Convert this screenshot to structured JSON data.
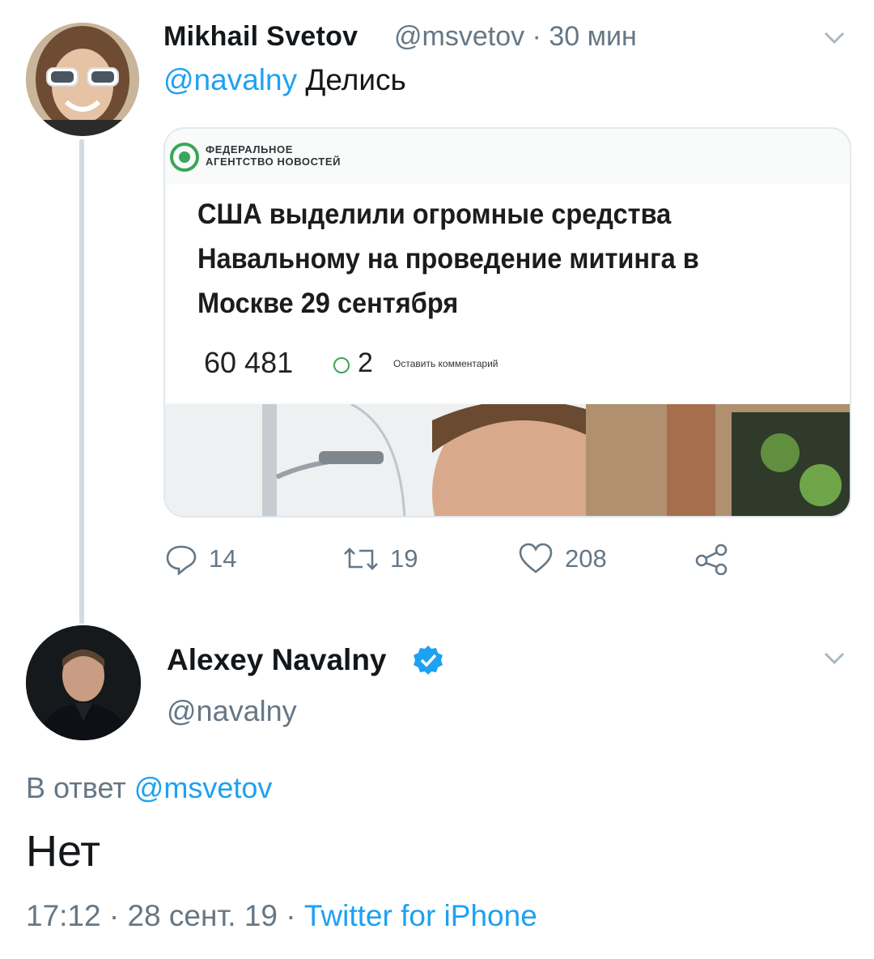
{
  "tweet1": {
    "name": "Mikhail Svetov",
    "handle_time": "@msvetov · 30 мин",
    "mention": "@navalny",
    "text": "Делись",
    "card": {
      "logo_line1": "ФЕДЕРАЛЬНОЕ",
      "logo_line2": "АГЕНТСТВО НОВОСТЕЙ",
      "headline": "США выделили огромные средства Навальному на проведение митинга в Москве 29 сентября",
      "views": "60 481",
      "comments": "2",
      "leave_comment": "Оставить комментарий"
    },
    "actions": {
      "replies": "14",
      "retweets": "19",
      "likes": "208"
    }
  },
  "tweet2": {
    "name": "Alexey Navalny",
    "handle": "@navalny",
    "reply_prefix": "В ответ",
    "reply_mention": "@msvetov",
    "text": "Нет",
    "timestamp": "17:12 · 28 сент. 19 ·",
    "source": "Twitter for iPhone"
  },
  "colors": {
    "accent": "#1da1f2",
    "secondary_text": "#657786",
    "verified": "#1da1f2"
  },
  "icons": [
    "chevron-down-icon",
    "reply-icon",
    "retweet-icon",
    "like-icon",
    "share-icon",
    "verified-badge-icon"
  ]
}
